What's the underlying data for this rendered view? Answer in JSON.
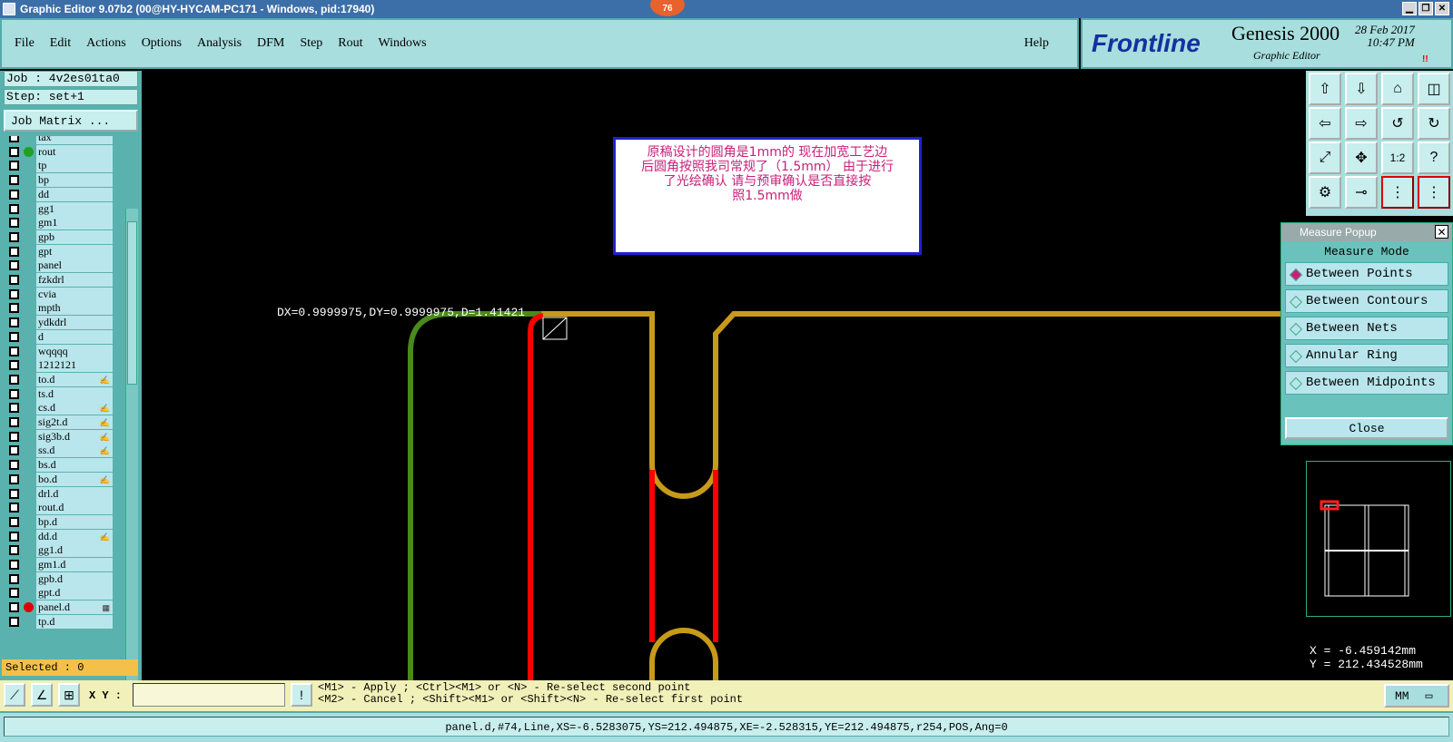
{
  "window": {
    "title": "Graphic Editor 9.07b2 (00@HY-HYCAM-PC171 - Windows, pid:17940)",
    "badge": "76"
  },
  "menu": {
    "file": "File",
    "edit": "Edit",
    "actions": "Actions",
    "options": "Options",
    "analysis": "Analysis",
    "dfm": "DFM",
    "step": "Step",
    "rout": "Rout",
    "windows": "Windows",
    "help": "Help"
  },
  "brand": {
    "logo": "Frontline",
    "product": "Genesis 2000",
    "subtitle": "Graphic Editor",
    "date": "28 Feb 2017",
    "time": "10:47 PM",
    "indicator": "!!"
  },
  "job": {
    "job": "Job : 4v2es01ta0",
    "step": "Step: set+1",
    "matrix": "Job Matrix ...",
    "selected": "Selected : 0"
  },
  "layers": [
    {
      "name": "tax",
      "flag": ""
    },
    {
      "name": "rout",
      "flag": "",
      "dot": "#20a020"
    },
    {
      "name": "tp",
      "flag": ""
    },
    {
      "name": "bp",
      "flag": ""
    },
    {
      "name": "dd",
      "flag": ""
    },
    {
      "name": "gg1",
      "flag": ""
    },
    {
      "name": "gm1",
      "flag": ""
    },
    {
      "name": "gpb",
      "flag": ""
    },
    {
      "name": "gpt",
      "flag": ""
    },
    {
      "name": "panel",
      "flag": ""
    },
    {
      "name": "fzkdrl",
      "flag": ""
    },
    {
      "name": "cvia",
      "flag": ""
    },
    {
      "name": "mpth",
      "flag": ""
    },
    {
      "name": "ydkdrl",
      "flag": ""
    },
    {
      "name": "d",
      "flag": ""
    },
    {
      "name": "wqqqq",
      "flag": ""
    },
    {
      "name": "1212121",
      "flag": ""
    },
    {
      "name": "to.d",
      "flag": "✍"
    },
    {
      "name": "ts.d",
      "flag": ""
    },
    {
      "name": "cs.d",
      "flag": "✍"
    },
    {
      "name": "sig2t.d",
      "flag": "✍"
    },
    {
      "name": "sig3b.d",
      "flag": "✍"
    },
    {
      "name": "ss.d",
      "flag": "✍"
    },
    {
      "name": "bs.d",
      "flag": ""
    },
    {
      "name": "bo.d",
      "flag": "✍"
    },
    {
      "name": "drl.d",
      "flag": ""
    },
    {
      "name": "rout.d",
      "flag": ""
    },
    {
      "name": "bp.d",
      "flag": ""
    },
    {
      "name": "dd.d",
      "flag": "✍"
    },
    {
      "name": "gg1.d",
      "flag": ""
    },
    {
      "name": "gm1.d",
      "flag": ""
    },
    {
      "name": "gpb.d",
      "flag": ""
    },
    {
      "name": "gpt.d",
      "flag": ""
    },
    {
      "name": "panel.d",
      "flag": "▦",
      "dot": "#e00000"
    },
    {
      "name": "tp.d",
      "flag": ""
    }
  ],
  "canvas": {
    "note_line1": "原稿设计的圆角是1mm的   现在加宽工艺边",
    "note_line2": "后圆角按照我司常规了（1.5mm） 由于进行",
    "note_line3": "了光绘确认  请与预审确认是否直接按",
    "note_line4": "照1.5mm做",
    "measure": "DX=0.9999975,DY=0.9999975,D=1.41421"
  },
  "tools": {
    "ratio_label": "1:2",
    "help_label": "?"
  },
  "popup": {
    "title": "Measure Popup",
    "mode": "Measure Mode",
    "options": [
      "Between Points",
      "Between Contours",
      "Between Nets",
      "Annular Ring",
      "Between Midpoints"
    ],
    "close": "Close"
  },
  "coords": {
    "x": "X =  -6.459142mm",
    "y": "Y =  212.434528mm"
  },
  "bottom": {
    "xy_label": "X Y :",
    "xy_value": "",
    "hint1": "<M1> - Apply  ; <Ctrl><M1> or <N> - Re-select second point",
    "hint2": "<M2> - Cancel ; <Shift><M1> or <Shift><N> - Re-select first point",
    "units": "MM"
  },
  "status": "panel.d,#74,Line,XS=-6.5283075,YS=212.494875,XE=-2.528315,YE=212.494875,r254,POS,Ang=0",
  "colors": {
    "accent": "#a8dede",
    "rout": "#c79a1a",
    "panel": "#ff0000",
    "profile": "#4b8a18"
  }
}
